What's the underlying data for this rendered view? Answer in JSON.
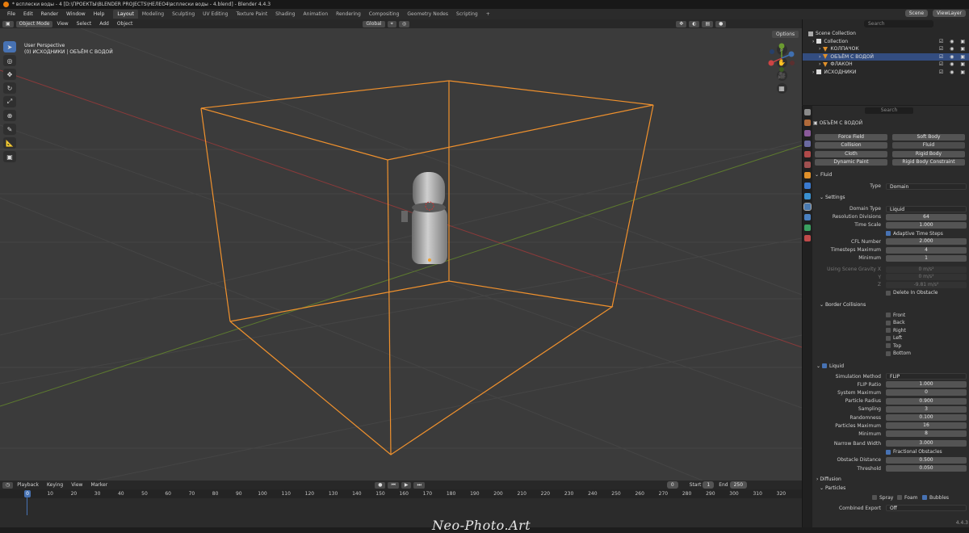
{
  "window": {
    "title": "* всплески воды - 4 [D:\\ПРОЕКТЫ\\BLENDER PROJECTS\\НЕЛЕО4\\всплески воды - 4.blend] - Blender 4.4.3"
  },
  "menu": [
    "File",
    "Edit",
    "Render",
    "Window",
    "Help"
  ],
  "workspaces": [
    "Layout",
    "Modeling",
    "Sculpting",
    "UV Editing",
    "Texture Paint",
    "Shading",
    "Animation",
    "Rendering",
    "Compositing",
    "Geometry Nodes",
    "Scripting",
    "+"
  ],
  "scene": {
    "scene_label": "Scene",
    "view_layer": "ViewLayer"
  },
  "viewport_header": {
    "mode": "Object Mode",
    "menus": [
      "View",
      "Select",
      "Add",
      "Object"
    ],
    "orientation": "Global"
  },
  "viewport": {
    "perspective": "User Perspective",
    "collection_info": "(0) ИСХОДНИКИ | ОБЪЁМ С ВОДОЙ",
    "options": "Options"
  },
  "timeline": {
    "menus": [
      "Playback",
      "Keying",
      "View",
      "Marker"
    ],
    "current_frame": "0",
    "start_label": "Start",
    "start": "1",
    "end_label": "End",
    "end": "250",
    "ruler": [
      "0",
      "10",
      "20",
      "30",
      "40",
      "50",
      "60",
      "70",
      "80",
      "90",
      "100",
      "110",
      "120",
      "130",
      "140",
      "150",
      "160",
      "170",
      "180",
      "190",
      "200",
      "210",
      "220",
      "230",
      "240",
      "250",
      "260",
      "270",
      "280",
      "290",
      "300",
      "310",
      "320"
    ],
    "watermark": "Neo-Photo.Art"
  },
  "outliner": {
    "search_placeholder": "Search",
    "rows": [
      {
        "name": "Scene Collection",
        "indent": 0,
        "kind": "scene",
        "selected": false
      },
      {
        "name": "Collection",
        "indent": 1,
        "kind": "collection",
        "selected": false
      },
      {
        "name": "КОЛПАЧОК",
        "indent": 2,
        "kind": "object",
        "selected": false
      },
      {
        "name": "ОБЪЁМ С ВОДОЙ",
        "indent": 2,
        "kind": "object",
        "selected": true
      },
      {
        "name": "ФЛАКОН",
        "indent": 2,
        "kind": "object",
        "selected": false
      },
      {
        "name": "ИСХОДНИКИ",
        "indent": 1,
        "kind": "collection",
        "selected": false
      }
    ]
  },
  "properties": {
    "search_placeholder": "Search",
    "object_name": "ОБЪЁМ С ВОДОЙ",
    "physics_buttons": [
      [
        "Force Field",
        "Soft Body"
      ],
      [
        "Collision",
        "Fluid"
      ],
      [
        "Cloth",
        "Rigid Body"
      ],
      [
        "Dynamic Paint",
        "Rigid Body Constraint"
      ]
    ],
    "fluid_section": "Fluid",
    "type_label": "Type",
    "type_value": "Domain",
    "settings_section": "Settings",
    "settings": [
      {
        "label": "Domain Type",
        "value": "Liquid",
        "kind": "dropdown"
      },
      {
        "label": "Resolution Divisions",
        "value": "64",
        "kind": "num"
      },
      {
        "label": "Time Scale",
        "value": "1.000",
        "kind": "num"
      },
      {
        "label": "Adaptive Time Steps",
        "value": "",
        "kind": "check_on"
      },
      {
        "label": "CFL Number",
        "value": "2.000",
        "kind": "num"
      },
      {
        "label": "Timesteps Maximum",
        "value": "4",
        "kind": "num"
      },
      {
        "label": "Minimum",
        "value": "1",
        "kind": "num"
      },
      {
        "label": "Using Scene Gravity X",
        "value": "0 m/s²",
        "kind": "dis"
      },
      {
        "label": "Y",
        "value": "0 m/s²",
        "kind": "dis"
      },
      {
        "label": "Z",
        "value": "-9.81 m/s²",
        "kind": "dis"
      },
      {
        "label": "Delete In Obstacle",
        "value": "",
        "kind": "check_off"
      }
    ],
    "border_section": "Border Collisions",
    "border": [
      "Front",
      "Back",
      "Right",
      "Left",
      "Top",
      "Bottom"
    ],
    "liquid_section": "Liquid",
    "liquid": [
      {
        "label": "Simulation Method",
        "value": "FLIP",
        "kind": "dropdown"
      },
      {
        "label": "FLIP Ratio",
        "value": "1.000",
        "kind": "num"
      },
      {
        "label": "System Maximum",
        "value": "0",
        "kind": "num"
      },
      {
        "label": "Particle Radius",
        "value": "0.900",
        "kind": "num"
      },
      {
        "label": "Sampling",
        "value": "3",
        "kind": "num"
      },
      {
        "label": "Randomness",
        "value": "0.100",
        "kind": "num"
      },
      {
        "label": "Particles Maximum",
        "value": "16",
        "kind": "num"
      },
      {
        "label": "Minimum",
        "value": "8",
        "kind": "num"
      },
      {
        "label": "Narrow Band Width",
        "value": "3.000",
        "kind": "num"
      },
      {
        "label": "Fractional Obstacles",
        "value": "",
        "kind": "check_on"
      },
      {
        "label": "Obstacle Distance",
        "value": "0.500",
        "kind": "num"
      },
      {
        "label": "Threshold",
        "value": "0.050",
        "kind": "num"
      }
    ],
    "diffusion_section": "Diffusion",
    "particles_section": "Particles",
    "particle_opts": [
      {
        "label": "Spray",
        "on": false
      },
      {
        "label": "Foam",
        "on": false
      },
      {
        "label": "Bubbles",
        "on": true
      }
    ],
    "combined_label": "Combined Export",
    "combined_value": "Off",
    "version": "4.4.3"
  }
}
